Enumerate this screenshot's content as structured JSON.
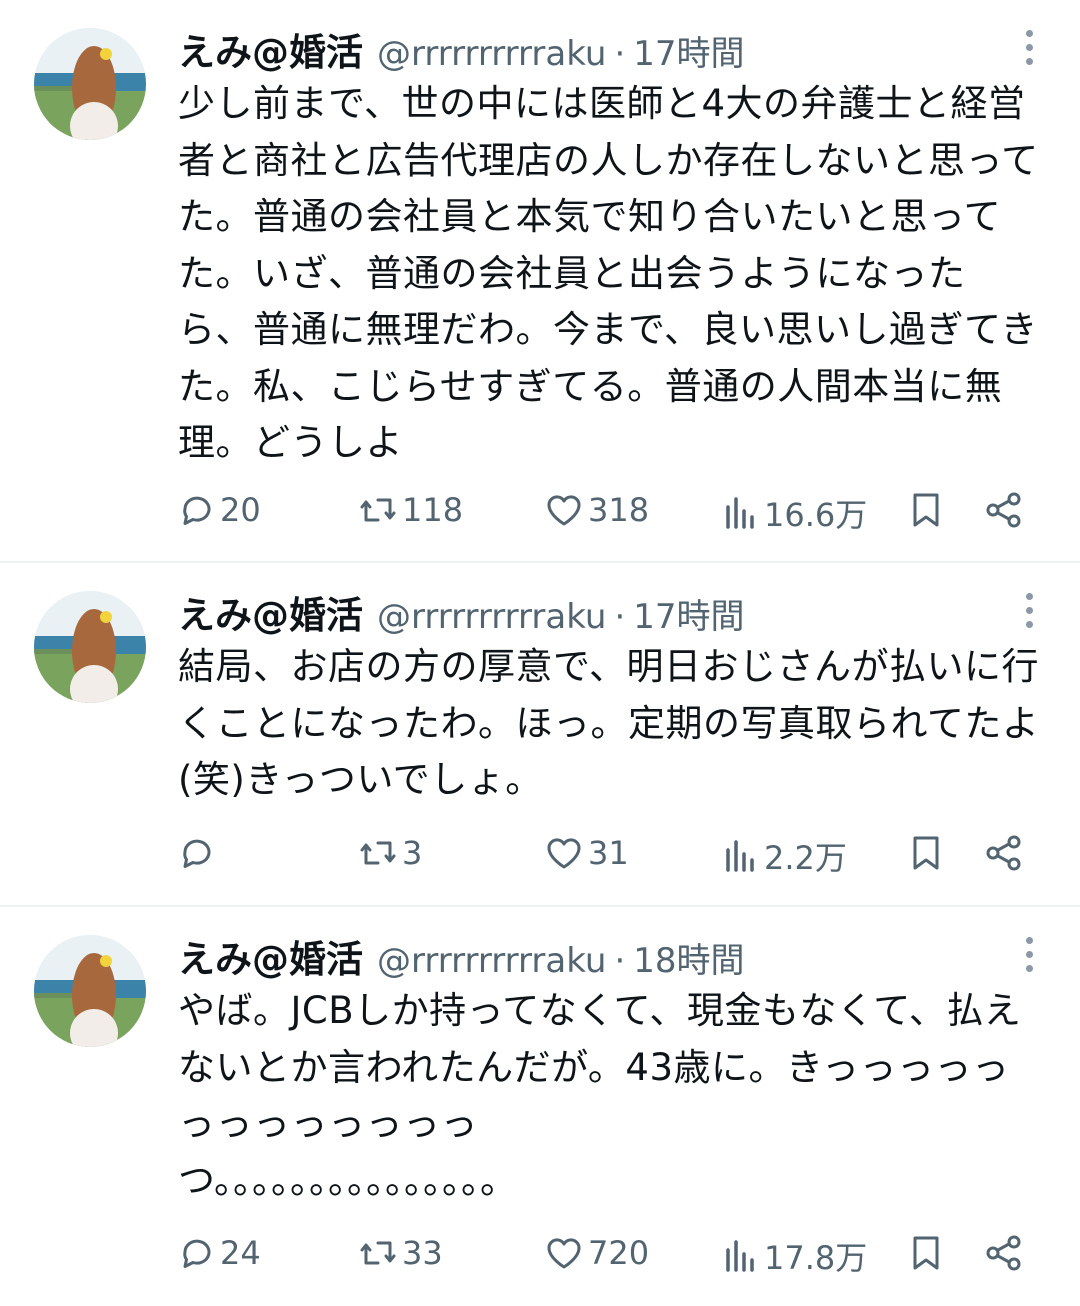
{
  "tweets": [
    {
      "name": "えみ@婚活",
      "handle": "@rrrrrrrrrraku",
      "separator": "·",
      "time": "17時間",
      "text": "少し前まで、世の中には医師と4大の弁護士と経営者と商社と広告代理店の人しか存在しないと思ってた。普通の会社員と本気で知り合いたいと思ってた。いざ、普通の会社員と出会うようになったら、普通に無理だわ。今まで、良い思いし過ぎてきた。私、こじらせすぎてる。普通の人間本当に無理。どうしよ",
      "replies": "20",
      "retweets": "118",
      "likes": "318",
      "views": "16.6万"
    },
    {
      "name": "えみ@婚活",
      "handle": "@rrrrrrrrrraku",
      "separator": "·",
      "time": "17時間",
      "text": "結局、お店の方の厚意で、明日おじさんが払いに行くことになったわ。ほっ。定期の写真取られてたよ(笑)きっついでしょ。",
      "replies": "",
      "retweets": "3",
      "likes": "31",
      "views": "2.2万"
    },
    {
      "name": "えみ@婚活",
      "handle": "@rrrrrrrrrraku",
      "separator": "·",
      "time": "18時間",
      "text": "やば。JCBしか持ってなくて、現金もなくて、払えないとか言われたんだが。43歳に。きっっっっっっっっっっっっっ\nつ。。。。。。。。。。。。。。。",
      "replies": "24",
      "retweets": "33",
      "likes": "720",
      "views": "17.8万"
    }
  ],
  "icons": {
    "reply": "speech-bubble-icon",
    "retweet": "retweet-arrows-icon",
    "like": "heart-icon",
    "views": "bar-chart-icon",
    "bookmark": "bookmark-icon",
    "share": "share-icon",
    "more": "vertical-ellipsis-icon"
  },
  "colors": {
    "text": "#0f1419",
    "secondary": "#536471",
    "divider": "#eff3f4"
  }
}
